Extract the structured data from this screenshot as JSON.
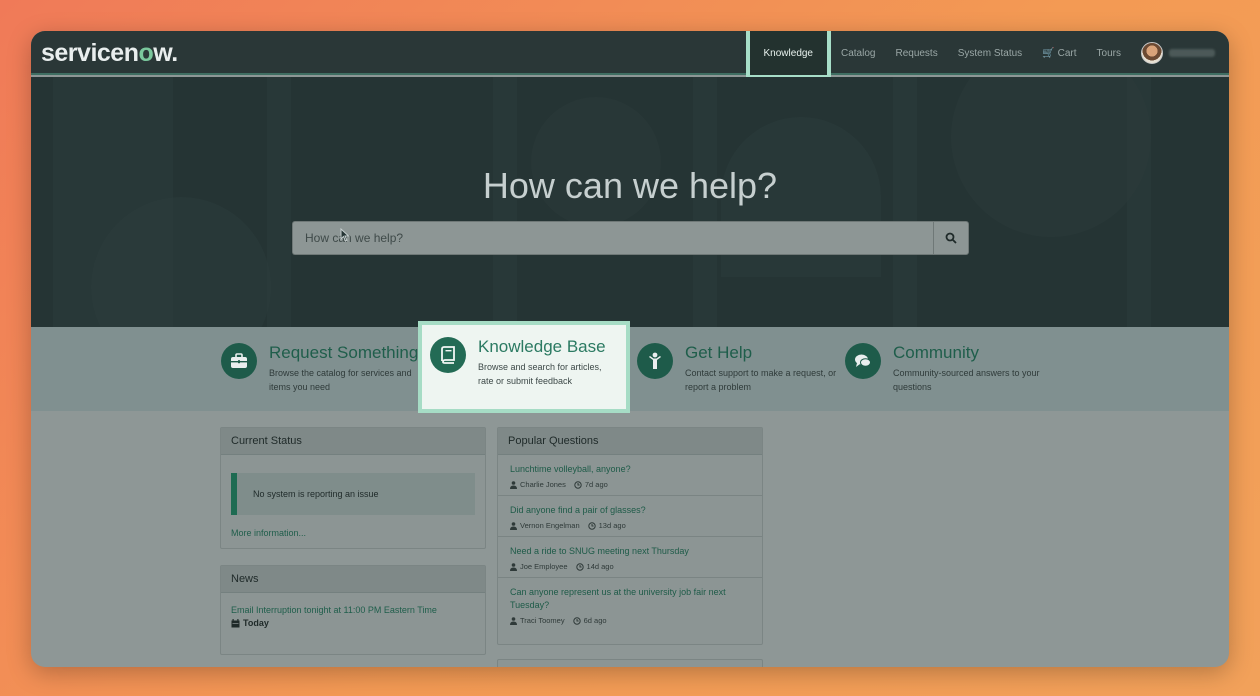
{
  "brand": {
    "logo_pre": "servicen",
    "logo_o": "o",
    "logo_post": "w",
    "logo_dot": "."
  },
  "nav": {
    "items": [
      {
        "label": "Knowledge",
        "active": true
      },
      {
        "label": "Catalog"
      },
      {
        "label": "Requests"
      },
      {
        "label": "System Status"
      },
      {
        "label": "Cart"
      },
      {
        "label": "Tours"
      }
    ]
  },
  "hero": {
    "heading": "How can we help?",
    "search_placeholder": "How can we help?"
  },
  "categories": [
    {
      "title": "Request Something",
      "desc": "Browse the catalog for services and items you need",
      "icon": "briefcase-icon"
    },
    {
      "title": "Knowledge Base",
      "desc": "Browse and search for articles, rate or submit feedback",
      "icon": "book-icon"
    },
    {
      "title": "Get Help",
      "desc": "Contact support to make a request, or report a problem",
      "icon": "person-icon"
    },
    {
      "title": "Community",
      "desc": "Community-sourced answers to your questions",
      "icon": "chat-icon"
    }
  ],
  "current_status": {
    "title": "Current Status",
    "message": "No system is reporting an issue",
    "more_link": "More information..."
  },
  "news": {
    "title": "News",
    "items": [
      {
        "title": "Email Interruption tonight at 11:00 PM Eastern Time",
        "when": "Today"
      }
    ]
  },
  "popular_questions": {
    "title": "Popular Questions",
    "items": [
      {
        "question": "Lunchtime volleyball, anyone?",
        "author": "Charlie Jones",
        "age": "7d ago"
      },
      {
        "question": "Did anyone find a pair of glasses?",
        "author": "Vernon Engelman",
        "age": "13d ago"
      },
      {
        "question": "Need a ride to SNUG meeting next Thursday",
        "author": "Joe Employee",
        "age": "14d ago"
      },
      {
        "question": "Can anyone represent us at the university job fair next Tuesday?",
        "author": "Traci Toomey",
        "age": "6d ago"
      }
    ]
  },
  "colors": {
    "accent": "#1e5b4a",
    "highlight_border": "#a6dcc5",
    "nav_bg": "#2a3737"
  }
}
